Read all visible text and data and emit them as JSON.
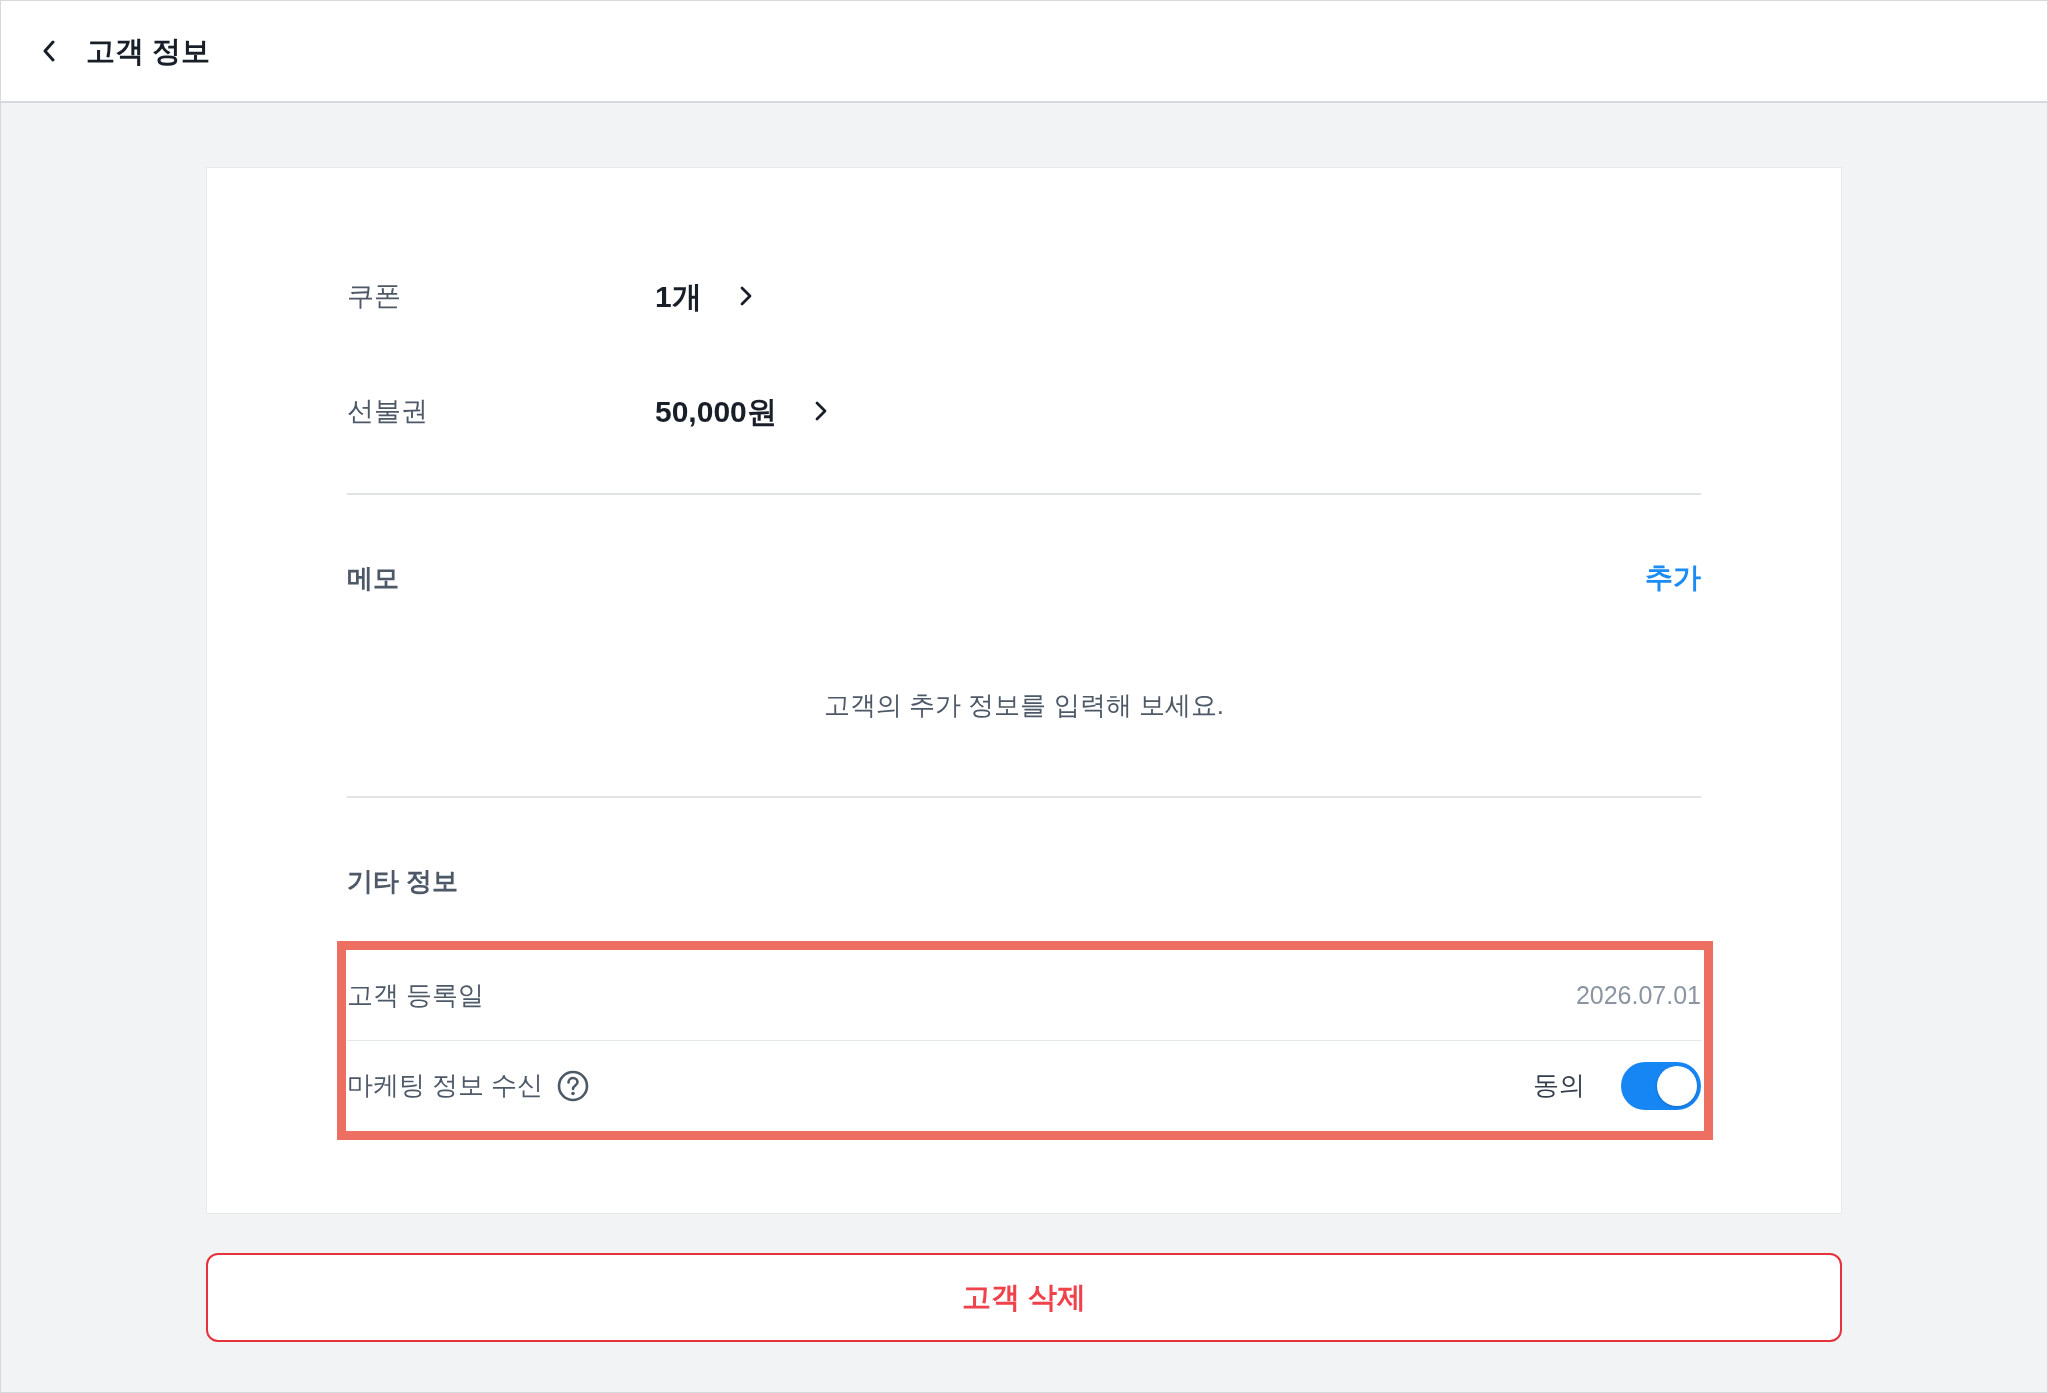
{
  "header": {
    "title": "고객 정보"
  },
  "summary": [
    {
      "label": "쿠폰",
      "value": "1개"
    },
    {
      "label": "선불권",
      "value": "50,000원"
    }
  ],
  "memo": {
    "title": "메모",
    "action": "추가",
    "empty_message": "고객의 추가 정보를 입력해 보세요."
  },
  "other_info": {
    "title": "기타 정보",
    "highlighted": true,
    "rows": [
      {
        "kind": "text",
        "label": "고객 등록일",
        "value": "2026.07.01"
      },
      {
        "kind": "toggle",
        "label": "마케팅 정보 수신",
        "help": true,
        "value": "동의",
        "on": true
      }
    ]
  },
  "delete_button": {
    "label": "고객 삭제"
  }
}
